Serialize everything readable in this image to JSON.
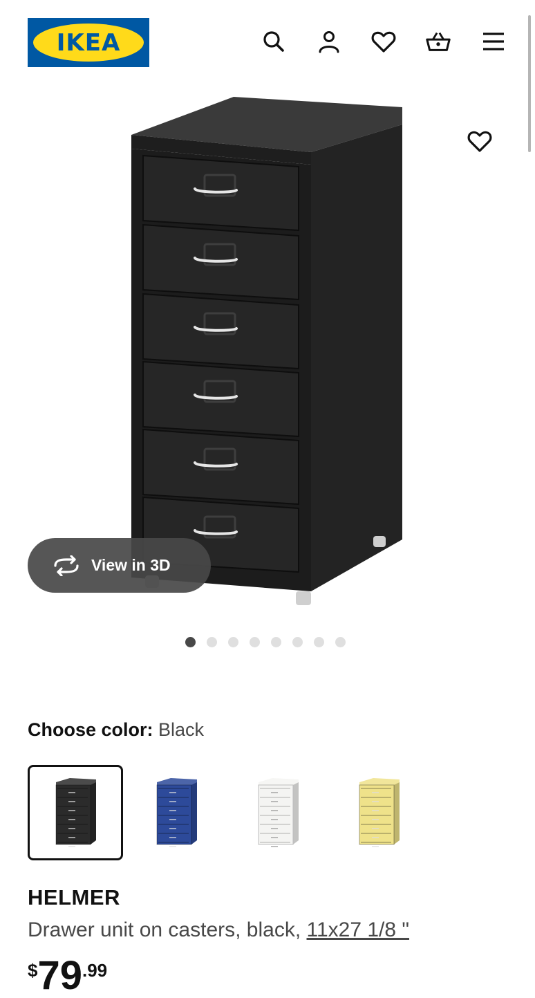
{
  "header": {
    "logo_text": "IKEA",
    "icons": [
      "search-icon",
      "account-icon",
      "heart-icon",
      "basket-icon",
      "menu-icon"
    ]
  },
  "product_image": {
    "view_in_3d_label": "View in 3D",
    "gallery_count": 8,
    "gallery_active_index": 0
  },
  "color": {
    "label": "Choose color:",
    "selected": "Black",
    "options": [
      {
        "name": "black",
        "hex": "#2b2b2b"
      },
      {
        "name": "blue",
        "hex": "#2d4a9a"
      },
      {
        "name": "white",
        "hex": "#f4f4f2"
      },
      {
        "name": "yellow",
        "hex": "#efe28a"
      }
    ]
  },
  "product": {
    "name": "HELMER",
    "description": "Drawer unit on casters, black, ",
    "dimensions": "11x27 1/8 \"",
    "price": {
      "currency": "$",
      "integer": "79",
      "decimal": ".99"
    }
  },
  "colors": {
    "ikea_blue": "#0058a3",
    "ikea_yellow": "#ffda1a",
    "text": "#111111",
    "muted": "#484848"
  }
}
